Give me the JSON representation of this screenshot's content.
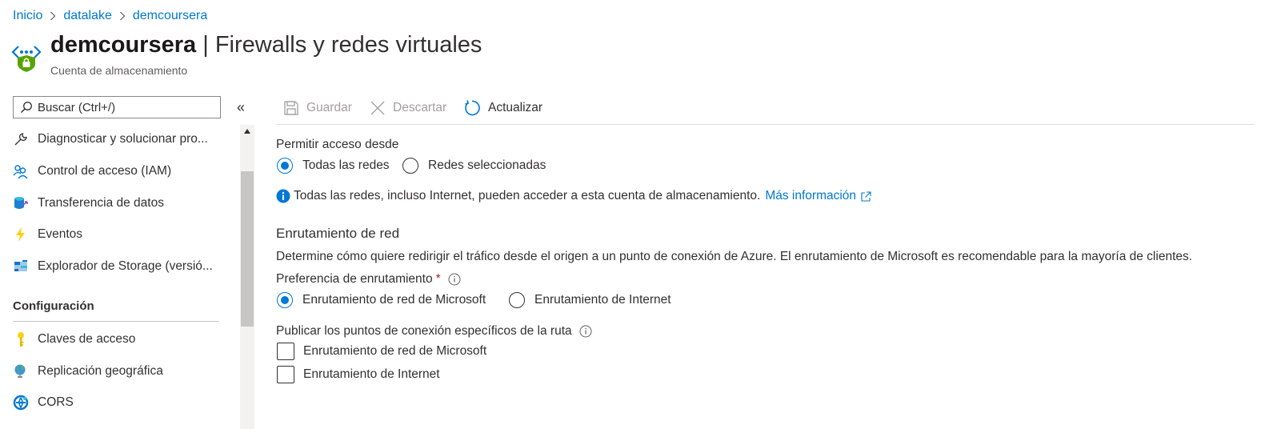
{
  "breadcrumb": {
    "items": [
      "Inicio",
      "datalake",
      "demcoursera"
    ]
  },
  "header": {
    "resource_name": "demcoursera",
    "separator": "|",
    "section_title": "Firewalls y redes virtuales",
    "subtitle": "Cuenta de almacenamiento"
  },
  "sidebar": {
    "search_placeholder": "Buscar (Ctrl+/)",
    "collapse_glyph": "«",
    "items": [
      {
        "label": "Diagnosticar y solucionar pro...",
        "icon": "wrench-icon"
      },
      {
        "label": "Control de acceso (IAM)",
        "icon": "people-icon"
      },
      {
        "label": "Transferencia de datos",
        "icon": "data-transfer-icon"
      },
      {
        "label": "Eventos",
        "icon": "lightning-icon"
      },
      {
        "label": "Explorador de Storage (versió...",
        "icon": "storage-explorer-icon"
      }
    ],
    "group_label": "Configuración",
    "group_items": [
      {
        "label": "Claves de acceso",
        "icon": "key-icon"
      },
      {
        "label": "Replicación geográfica",
        "icon": "globe-icon"
      },
      {
        "label": "CORS",
        "icon": "cors-icon"
      }
    ]
  },
  "toolbar": {
    "save_label": "Guardar",
    "discard_label": "Descartar",
    "refresh_label": "Actualizar"
  },
  "access": {
    "label": "Permitir acceso desde",
    "options": [
      "Todas las redes",
      "Redes seleccionadas"
    ],
    "selected": "Todas las redes",
    "info_text": "Todas las redes, incluso Internet, pueden acceder a esta cuenta de almacenamiento.",
    "info_link": "Más información"
  },
  "routing": {
    "section_title": "Enrutamiento de red",
    "description": "Determine cómo quiere redirigir el tráfico desde el origen a un punto de conexión de Azure. El enrutamiento de Microsoft es recomendable para la mayoría de clientes.",
    "preference_label": "Preferencia de enrutamiento",
    "required_mark": "*",
    "preference_options": [
      "Enrutamiento de red de Microsoft",
      "Enrutamiento de Internet"
    ],
    "preference_selected": "Enrutamiento de red de Microsoft",
    "publish_label": "Publicar los puntos de conexión específicos de la ruta",
    "publish_options": [
      "Enrutamiento de red de Microsoft",
      "Enrutamiento de Internet"
    ]
  },
  "colors": {
    "accent": "#0078d4",
    "text": "#323130",
    "disabled": "#a19f9d"
  }
}
